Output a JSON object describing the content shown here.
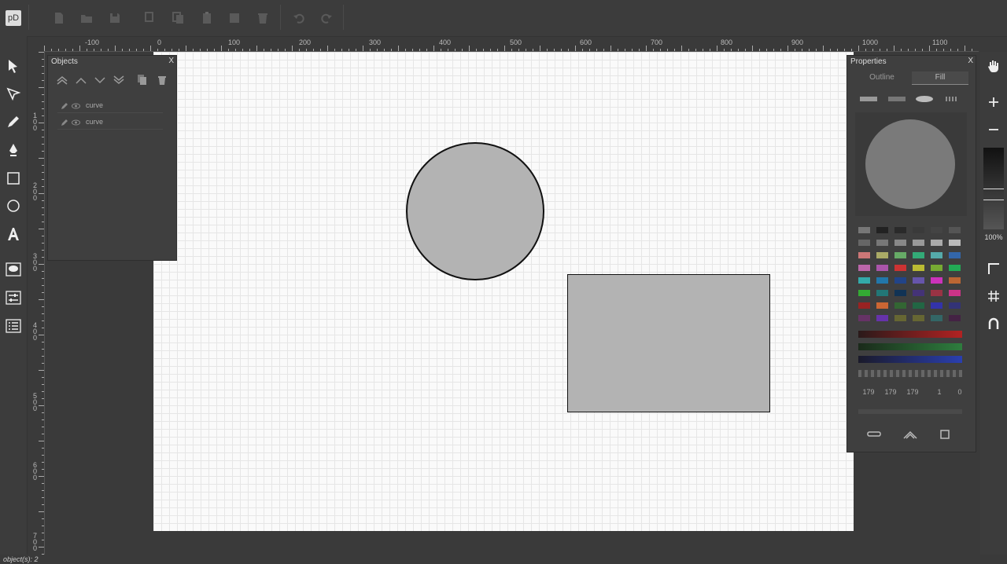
{
  "app": {
    "logo_text": "pD"
  },
  "ruler": {
    "h_labels": [
      "-100",
      "0",
      "100",
      "200",
      "300",
      "400",
      "500",
      "600",
      "700",
      "800",
      "900",
      "1000",
      "1100"
    ],
    "v_labels": [
      "1 0 0",
      "2 0 0",
      "3 0 0",
      "4 0 0",
      "5 0 0",
      "6 0 0",
      "7 0 0"
    ]
  },
  "objects_panel": {
    "title": "Objects",
    "close": "X",
    "items": [
      {
        "label": "curve"
      },
      {
        "label": "curve"
      }
    ]
  },
  "properties_panel": {
    "title": "Properties",
    "close": "X",
    "tabs": {
      "outline": "Outline",
      "fill": "Fill"
    },
    "active_tab": "Fill",
    "fill_color": "#b3b3b3",
    "rgba": {
      "r": "179",
      "g": "179",
      "b": "179",
      "a": "1",
      "extra": "0"
    }
  },
  "zoom": {
    "label": "100%"
  },
  "status": {
    "text": "object(s): 2"
  },
  "colors": {
    "accent_red": "#c0392b",
    "accent_green": "#2e8b3e",
    "accent_blue": "#2a3fb0",
    "shape_fill": "#b3b3b3"
  }
}
